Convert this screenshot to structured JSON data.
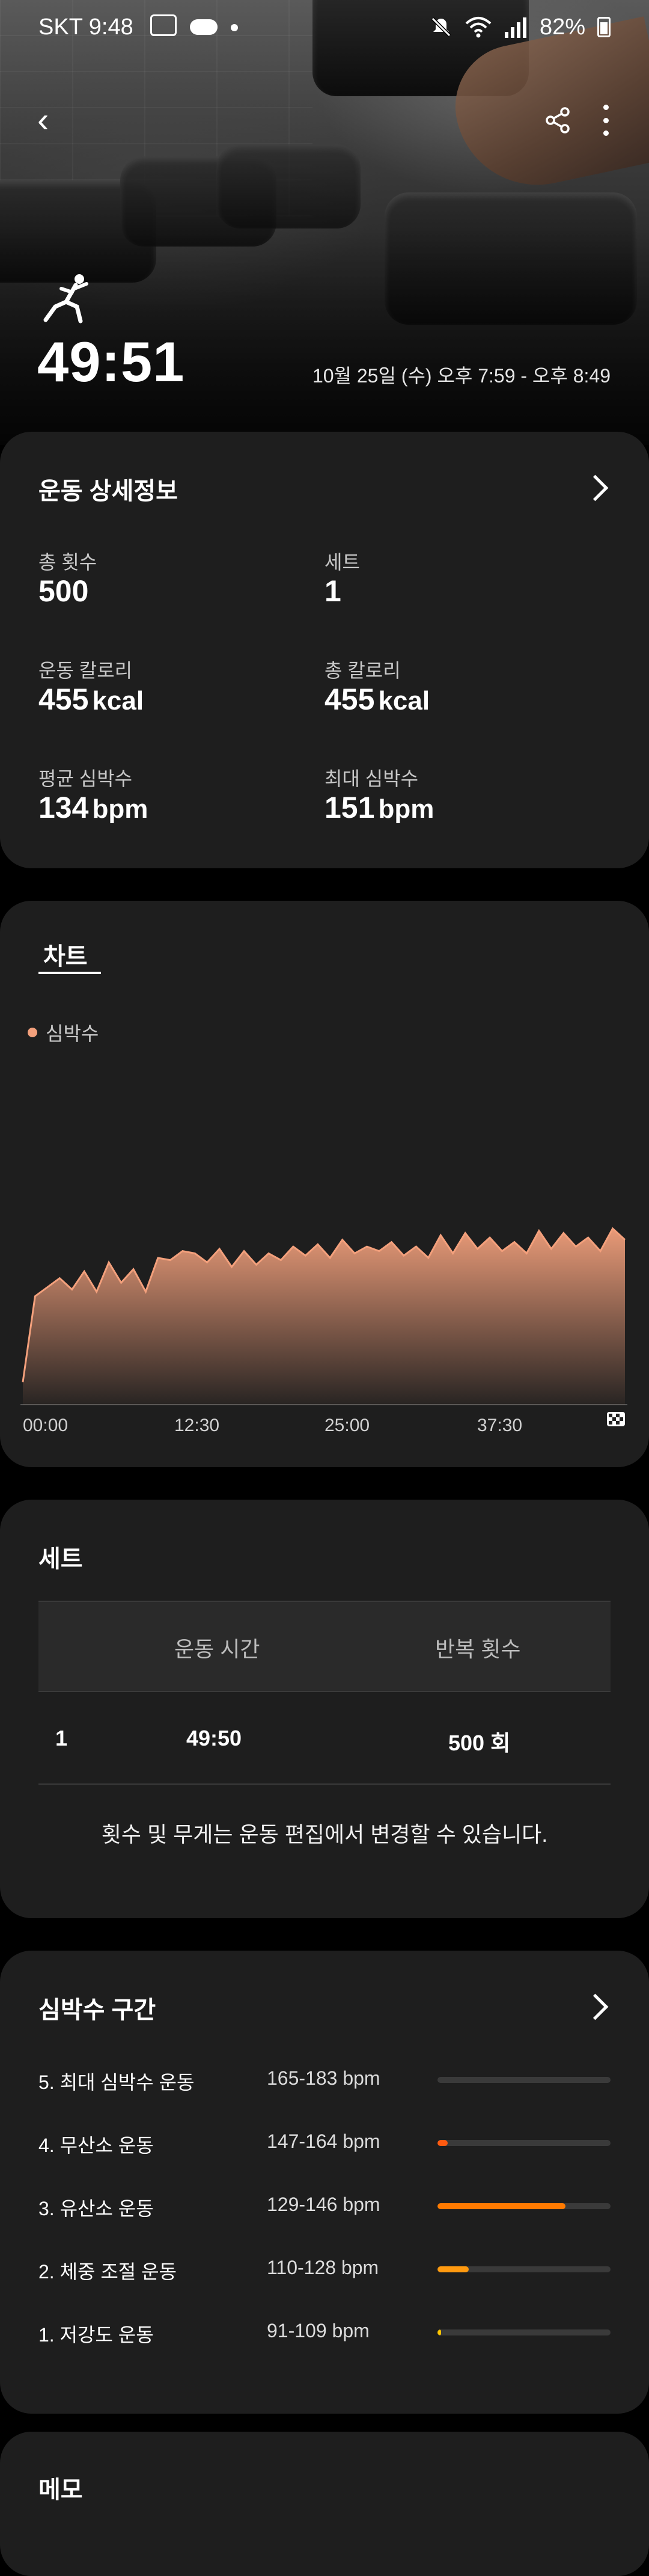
{
  "status_bar": {
    "carrier_time": "SKT 9:48",
    "battery": "82%",
    "icons": [
      "gallery-icon",
      "cloud-icon",
      "dot-icon",
      "mute-icon",
      "wifi-icon",
      "signal-icon",
      "battery-icon"
    ]
  },
  "header": {
    "back_icon": "back-arrow-icon",
    "share_icon": "share-icon",
    "more_icon": "more-vertical-icon",
    "workout_icon": "workout-figure-icon",
    "duration": "49:51",
    "datetime": "10월 25일 (수) 오후 7:59 - 오후 8:49"
  },
  "details": {
    "title": "운동 상세정보",
    "stats": [
      {
        "label": "총 횟수",
        "value": "500",
        "unit": ""
      },
      {
        "label": "세트",
        "value": "1",
        "unit": ""
      },
      {
        "label": "운동 칼로리",
        "value": "455",
        "unit": "kcal"
      },
      {
        "label": "총 칼로리",
        "value": "455",
        "unit": "kcal"
      },
      {
        "label": "평균 심박수",
        "value": "134",
        "unit": "bpm"
      },
      {
        "label": "최대 심박수",
        "value": "151",
        "unit": "bpm"
      }
    ]
  },
  "chart_section": {
    "tab": "차트",
    "legend": "심박수",
    "accent": "#f3a07c",
    "end_icon": "finish-flag-icon"
  },
  "chart_data": {
    "type": "area",
    "series": [
      {
        "name": "심박수"
      }
    ],
    "x_ticks": [
      "00:00",
      "12:30",
      "25:00",
      "37:30"
    ],
    "x": [
      0,
      1,
      2,
      3,
      4,
      5,
      6,
      7,
      8,
      9,
      10,
      11,
      12,
      13,
      14,
      15,
      16,
      17,
      18,
      19,
      20,
      21,
      22,
      23,
      24,
      25,
      26,
      27,
      28,
      29,
      30,
      31,
      32,
      33,
      34,
      35,
      36,
      37,
      38,
      39,
      40,
      41,
      42,
      43,
      44,
      45,
      46,
      47,
      48,
      49
    ],
    "values": [
      80,
      118,
      122,
      126,
      121,
      129,
      120,
      133,
      124,
      130,
      120,
      135,
      134,
      138,
      137,
      133,
      139,
      131,
      138,
      132,
      137,
      134,
      140,
      136,
      141,
      135,
      143,
      137,
      140,
      138,
      142,
      136,
      140,
      135,
      145,
      137,
      146,
      139,
      144,
      138,
      142,
      137,
      147,
      139,
      146,
      140,
      144,
      138,
      148,
      143
    ],
    "ylim": [
      70,
      160
    ]
  },
  "sets": {
    "title": "세트",
    "columns": [
      "운동 시간",
      "반복 횟수"
    ],
    "rows": [
      {
        "index": "1",
        "time": "49:50",
        "reps": "500 회"
      }
    ],
    "note": "횟수 및 무게는 운동 편집에서 변경할 수 있습니다."
  },
  "hr_zones": {
    "title": "심박수 구간",
    "zones": [
      {
        "name": "5. 최대 심박수 운동",
        "range": "165-183 bpm",
        "fraction": 0.0,
        "color": "#ff6a00"
      },
      {
        "name": "4. 무산소 운동",
        "range": "147-164 bpm",
        "fraction": 0.06,
        "color": "#ff5a10"
      },
      {
        "name": "3. 유산소 운동",
        "range": "129-146 bpm",
        "fraction": 0.74,
        "color": "#ff7a00"
      },
      {
        "name": "2. 체중 조절 운동",
        "range": "110-128 bpm",
        "fraction": 0.18,
        "color": "#ff9a10"
      },
      {
        "name": "1. 저강도 운동",
        "range": "91-109 bpm",
        "fraction": 0.02,
        "color": "#ffc400"
      }
    ]
  },
  "memo": {
    "title": "메모"
  }
}
